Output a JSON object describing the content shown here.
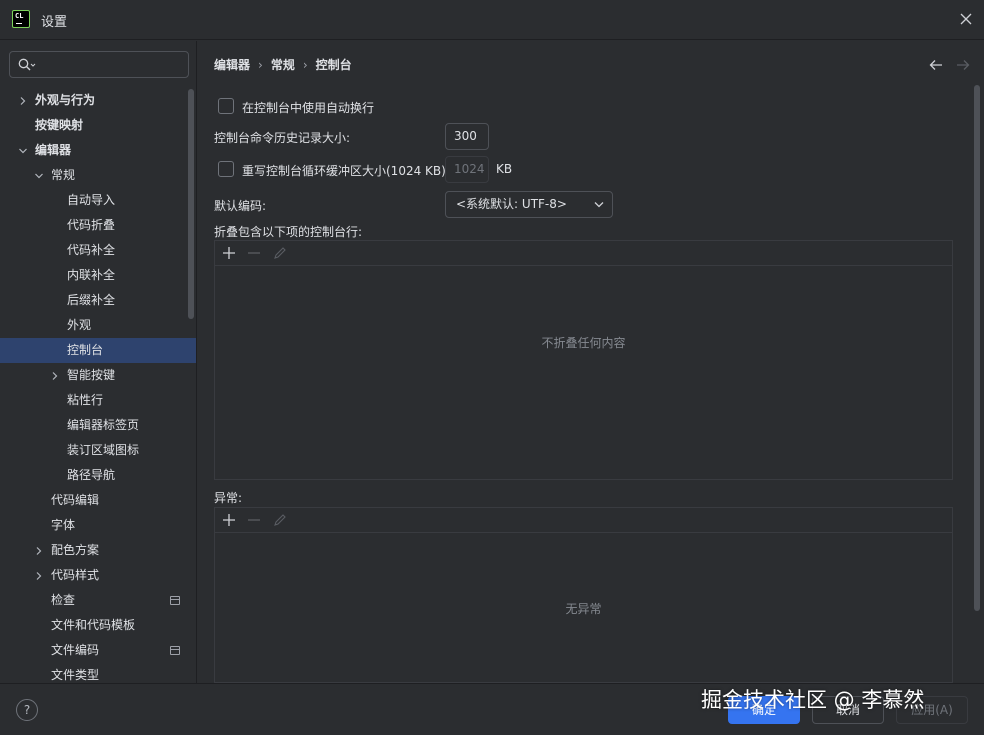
{
  "window": {
    "title": "设置",
    "app_icon_text": "CL"
  },
  "sidebar": {
    "search_placeholder": "",
    "items": [
      {
        "label": "外观与行为",
        "level": 0,
        "bold": true,
        "chevron": "right"
      },
      {
        "label": "按键映射",
        "level": 0,
        "bold": true,
        "chevron": "none"
      },
      {
        "label": "编辑器",
        "level": 0,
        "bold": true,
        "chevron": "down"
      },
      {
        "label": "常规",
        "level": 1,
        "bold": false,
        "chevron": "down"
      },
      {
        "label": "自动导入",
        "level": 2,
        "bold": false,
        "chevron": "none"
      },
      {
        "label": "代码折叠",
        "level": 2,
        "bold": false,
        "chevron": "none"
      },
      {
        "label": "代码补全",
        "level": 2,
        "bold": false,
        "chevron": "none"
      },
      {
        "label": "内联补全",
        "level": 2,
        "bold": false,
        "chevron": "none"
      },
      {
        "label": "后缀补全",
        "level": 2,
        "bold": false,
        "chevron": "none"
      },
      {
        "label": "外观",
        "level": 2,
        "bold": false,
        "chevron": "none"
      },
      {
        "label": "控制台",
        "level": 2,
        "bold": false,
        "chevron": "none",
        "selected": true
      },
      {
        "label": "智能按键",
        "level": 2,
        "bold": false,
        "chevron": "right"
      },
      {
        "label": "粘性行",
        "level": 2,
        "bold": false,
        "chevron": "none"
      },
      {
        "label": "编辑器标签页",
        "level": 2,
        "bold": false,
        "chevron": "none"
      },
      {
        "label": "装订区域图标",
        "level": 2,
        "bold": false,
        "chevron": "none"
      },
      {
        "label": "路径导航",
        "level": 2,
        "bold": false,
        "chevron": "none"
      },
      {
        "label": "代码编辑",
        "level": 1,
        "bold": false,
        "chevron": "none"
      },
      {
        "label": "字体",
        "level": 1,
        "bold": false,
        "chevron": "none"
      },
      {
        "label": "配色方案",
        "level": 1,
        "bold": false,
        "chevron": "right"
      },
      {
        "label": "代码样式",
        "level": 1,
        "bold": false,
        "chevron": "right"
      },
      {
        "label": "检查",
        "level": 1,
        "bold": false,
        "chevron": "none",
        "badge": true
      },
      {
        "label": "文件和代码模板",
        "level": 1,
        "bold": false,
        "chevron": "none"
      },
      {
        "label": "文件编码",
        "level": 1,
        "bold": false,
        "chevron": "none",
        "badge": true
      },
      {
        "label": "文件类型",
        "level": 1,
        "bold": false,
        "chevron": "none"
      }
    ]
  },
  "content": {
    "breadcrumb": [
      "编辑器",
      "常规",
      "控制台"
    ],
    "soft_wrap_label": "在控制台中使用自动换行",
    "history_label": "控制台命令历史记录大小:",
    "history_value": "300",
    "override_label": "重写控制台循环缓冲区大小(1024 KB)",
    "override_value": "1024",
    "override_unit": "KB",
    "encoding_label": "默认编码:",
    "encoding_value": "<系统默认: UTF-8>",
    "fold_label": "折叠包含以下项的控制台行:",
    "fold_empty": "不折叠任何内容",
    "exceptions_label": "异常:",
    "exceptions_empty": "无异常"
  },
  "footer": {
    "help": "?",
    "ok": "确定",
    "cancel": "取消",
    "apply": "应用(A)"
  },
  "watermark": "掘金技术社区 @ 李慕然",
  "colors": {
    "background": "#2b2d30",
    "selection": "#2e436e",
    "primary_button": "#3574f0",
    "text": "#dfe1e5"
  }
}
